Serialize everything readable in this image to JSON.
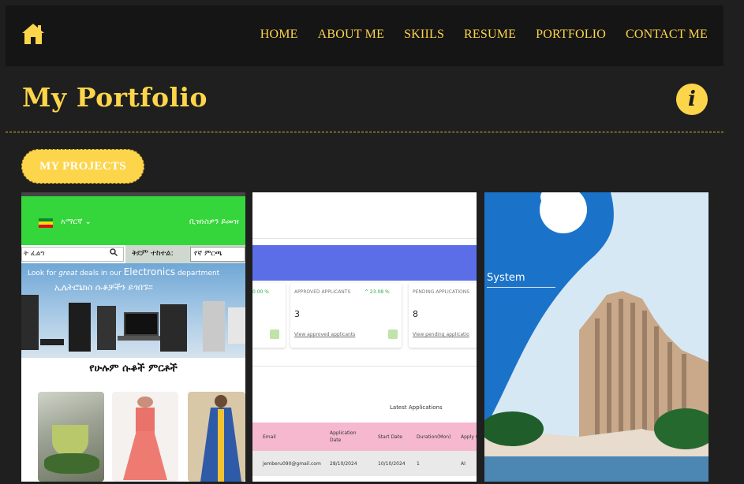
{
  "nav": {
    "home_icon": "home-icon",
    "links": [
      "HOME",
      "ABOUT ME",
      "SKIILS",
      "RESUME",
      "PORTFOLIO",
      "CONTACT ME"
    ]
  },
  "header": {
    "title": "My Portfolio",
    "info_icon": "i"
  },
  "projects_button": "MY PROJECTS",
  "colors": {
    "accent": "#fdd54a",
    "background": "#1f1f1f",
    "nav_background": "#151515"
  },
  "projects": [
    {
      "type": "ecommerce-screenshot",
      "lang_label": "አማርኛ ⌄",
      "header_tag": "ቢዝነስዎን ይመዝ",
      "search_placeholder": "ት ፈልግ",
      "sort_label": "ቅደም ተከተል:",
      "sort_value": "የኛ ምርጫ",
      "banner_text_1": "Look for ",
      "banner_text_2": "great",
      "banner_text_3": " deals in our ",
      "banner_text_4": "Electronics",
      "banner_text_5": " department",
      "banner_am": "ኢሌትሮኒክስ ሱቆቻችን ይጎበኙ።",
      "section_title": "የሁሉም ሱቆች ምርቶች"
    },
    {
      "type": "dashboard-screenshot",
      "stat_partial_pct": "0.00 %",
      "stats": [
        {
          "label": "APPROVED APPLICANTS",
          "pct": "^ 23.08 %",
          "value": "3",
          "link": "View approved applicants"
        },
        {
          "label": "PENDING APPLICATIONS",
          "value": "8",
          "link": "View pending applicatio"
        }
      ],
      "latest_title": "Latest Applications",
      "table_headers": [
        "Email",
        "Application Date",
        "Start Date",
        "Duration(Mon)",
        "Apply C"
      ],
      "table_row": [
        "jemberu090@gmail.com",
        "28/10/2024",
        "10/10/2024",
        "1",
        "AI"
      ]
    },
    {
      "type": "hotel-screenshot",
      "caption": "System"
    }
  ]
}
